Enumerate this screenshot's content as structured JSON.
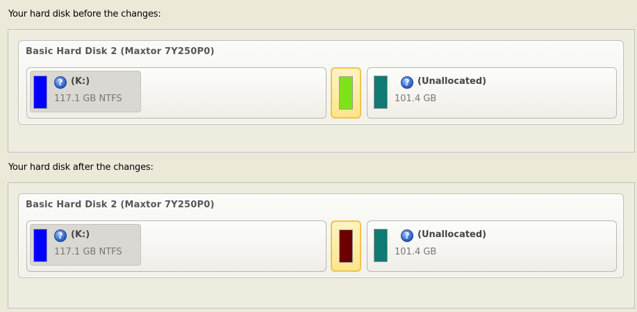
{
  "before": {
    "label": "Your hard disk before the changes:",
    "disk": {
      "title": "Basic Hard Disk 2 (Maxtor 7Y250P0)",
      "partitions": [
        {
          "name": "(K:)",
          "info": "117.1 GB NTFS",
          "color": "#0000ff"
        },
        {
          "color": "#7fe31c"
        },
        {
          "name": "(Unallocated)",
          "info": "101.4 GB",
          "color": "#0f7a72"
        }
      ]
    }
  },
  "after": {
    "label": "Your hard disk after the changes:",
    "disk": {
      "title": "Basic Hard Disk 2 (Maxtor 7Y250P0)",
      "partitions": [
        {
          "name": "(K:)",
          "info": "117.1 GB NTFS",
          "color": "#0000ff"
        },
        {
          "color": "#6b0000"
        },
        {
          "name": "(Unallocated)",
          "info": "101.4 GB",
          "color": "#0f7a72"
        }
      ]
    }
  },
  "icons": {
    "partition_info": "help-icon"
  }
}
